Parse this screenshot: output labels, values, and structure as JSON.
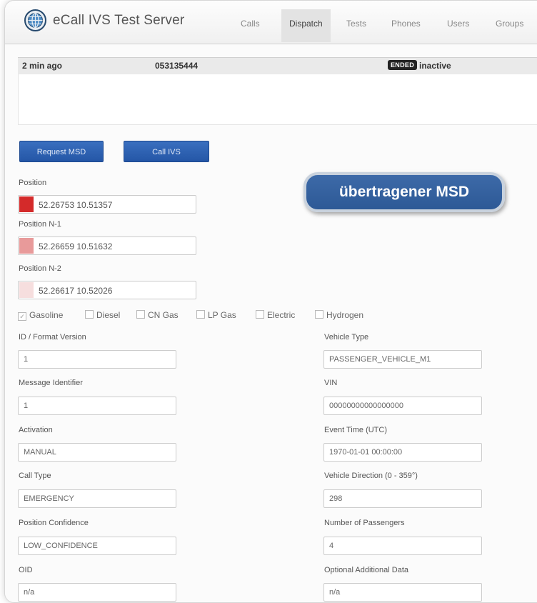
{
  "app": {
    "title": "eCall IVS Test Server"
  },
  "nav": {
    "tabs": [
      {
        "label": "Calls"
      },
      {
        "label": "Dispatch",
        "active": true
      },
      {
        "label": "Tests"
      },
      {
        "label": "Phones"
      },
      {
        "label": "Users"
      },
      {
        "label": "Groups"
      }
    ]
  },
  "call": {
    "time": "2 min ago",
    "number": "053135444",
    "badge": "ENDED",
    "status": "inactive"
  },
  "buttons": {
    "request_msd": "Request MSD",
    "call_ivs": "Call IVS"
  },
  "callout": "übertragener MSD",
  "positions": [
    {
      "label": "Position",
      "value": "52.26753 10.51357",
      "color": "#d42a2a"
    },
    {
      "label": "Position N-1",
      "value": "52.26659 10.51632",
      "color": "#e89a9a"
    },
    {
      "label": "Position N-2",
      "value": "52.26617 10.52026",
      "color": "#f6dede"
    }
  ],
  "fuel": [
    {
      "label": "Gasoline",
      "checked": true
    },
    {
      "label": "Diesel",
      "checked": false
    },
    {
      "label": "CN Gas",
      "checked": false
    },
    {
      "label": "LP Gas",
      "checked": false
    },
    {
      "label": "Electric",
      "checked": false
    },
    {
      "label": "Hydrogen",
      "checked": false
    }
  ],
  "fields_left": [
    {
      "label": "ID / Format Version",
      "value": "1"
    },
    {
      "label": "Message Identifier",
      "value": "1"
    },
    {
      "label": "Activation",
      "value": "MANUAL"
    },
    {
      "label": "Call Type",
      "value": "EMERGENCY"
    },
    {
      "label": "Position Confidence",
      "value": "LOW_CONFIDENCE"
    },
    {
      "label": "OID",
      "value": "n/a"
    }
  ],
  "fields_right": [
    {
      "label": "Vehicle Type",
      "value": "PASSENGER_VEHICLE_M1"
    },
    {
      "label": "VIN",
      "value": "00000000000000000"
    },
    {
      "label": "Event Time (UTC)",
      "value": "1970-01-01 00:00:00"
    },
    {
      "label": "Vehicle Direction (0 - 359°)",
      "value": "298"
    },
    {
      "label": "Number of Passengers",
      "value": "4"
    },
    {
      "label": "Optional Additional Data",
      "value": "n/a"
    }
  ],
  "colors": {
    "accent": "#2456a6",
    "callout": "#3461a0"
  }
}
